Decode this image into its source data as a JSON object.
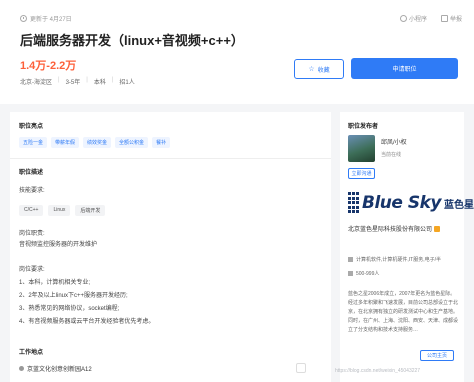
{
  "header": {
    "update": "更新于 4月27日",
    "tools": {
      "mini_program": "小程序",
      "report": "举报"
    },
    "title": "后端服务器开发（linux+音视频+c++）",
    "salary": "1.4万-2.2万",
    "tags": [
      "北京-海淀区",
      "3-5年",
      "本科",
      "招1人"
    ],
    "fav_label": "收藏",
    "apply_label": "申请职位"
  },
  "highlights": {
    "title": "职位亮点",
    "items": [
      "五险一金",
      "带薪年假",
      "绩效奖金",
      "全额公积金",
      "餐补"
    ]
  },
  "description": {
    "title": "职位描述",
    "skills_title": "技能要求:",
    "skills": [
      "C/C++",
      "Linux",
      "后端开发"
    ],
    "duty_title": "岗位职责:",
    "duty": "音视频监控服务器的开发维护",
    "req_title": "岗位要求:",
    "reqs": [
      "1、本科，计算机相关专业;",
      "2、2年及以上linux下c++服务器开发经历;",
      "3、熟悉常见的网络协议，socket编程;",
      "4、有音视频服务器或云平台开发经验者优先考虑。"
    ]
  },
  "work_location": {
    "title": "工作地点",
    "address": "京蓝文化创意创新园A12"
  },
  "recruiter": {
    "title": "职位发布者",
    "name": "邱凤/小权",
    "status": "当前在线",
    "chat_label": "立即沟通"
  },
  "company": {
    "logo_en": "Blue Sky",
    "logo_cn": "蓝色星际",
    "name": "北京蓝色星际科技股份有限公司",
    "industry": "计算机软件,计算机硬件,IT服务,电子/半",
    "size": "500-999人",
    "intro": "蓝色之星2006年成立，2007年更名为蓝色星际。经过多年积聚和飞速发展，目前公司总部设立于北京，在北京拥有独立的研发测试中心和生产基地。同时，在广州、上海、沈阳、西安、天津、成都设立了分支结构和技术支持服务…",
    "home_label": "公司主页"
  },
  "watermark": "https://blog.csdn.net/weixin_45043227"
}
